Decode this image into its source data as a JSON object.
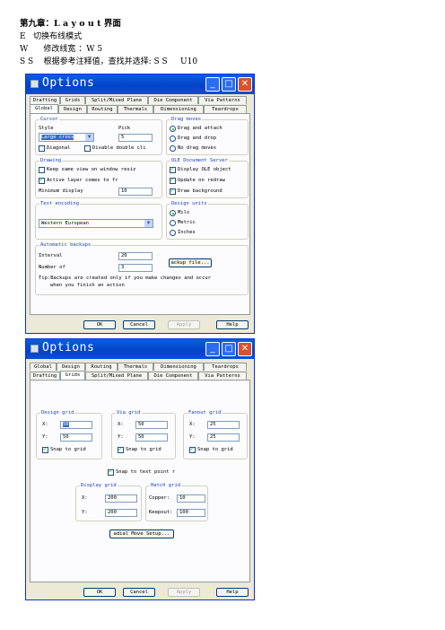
{
  "doc": {
    "heading": "第九章：L a y o u t 界面",
    "line1": "E   切换布线模式",
    "line2": "W      修改线宽 ：W 5",
    "line3": "S S    根据参考注释值，查找并选择: S S     U10"
  },
  "dialog1": {
    "title": "Options",
    "tabs_row1": [
      "Drafting",
      "Grids",
      "Split/Mixed Plane",
      "Die Component",
      "Via Patterns"
    ],
    "tabs_row2": [
      "Global",
      "Design",
      "Routing",
      "Thermals",
      "Dimensioning",
      "Teardrops"
    ],
    "cursor": {
      "label": "Cursor",
      "style_label": "Style",
      "style_value": "Large cross",
      "pick_label": "Pick",
      "pick_value": "5",
      "diagonal": "Diagonal",
      "disable_dbl": "Disable double cli"
    },
    "drag": {
      "label": "Drag moves",
      "opt1": "Drag and attach",
      "opt2": "Drag and drop",
      "opt3": "No drag moves"
    },
    "drawing": {
      "label": "Drawing",
      "keep_same": "Keep same view on window resiz",
      "active_layer": "Active layer comes to fr",
      "min_display_label": "Minimum display",
      "min_display_value": "10"
    },
    "ole": {
      "label": "OLE Document Server",
      "display": "Display OLE object",
      "update": "Update on redraw",
      "draw_bg": "Draw background"
    },
    "text_encoding": {
      "label": "Text encoding",
      "value": "Western European"
    },
    "design_units": {
      "label": "Design units",
      "mils": "Mils",
      "metric": "Metric",
      "inches": "Inches"
    },
    "backups": {
      "label": "Automatic backups",
      "interval_label": "Interval",
      "interval_value": "20",
      "number_label": "Number of",
      "number_value": "3",
      "button": "ackup file...",
      "tip1": "Tip:Backups are created only if you make changes and occur",
      "tip2": "when you finish an action"
    },
    "buttons": {
      "ok": "OK",
      "cancel": "Cancel",
      "apply": "Apply",
      "help": "Help"
    }
  },
  "dialog2": {
    "title": "Options",
    "tabs_row1": [
      "Global",
      "Design",
      "Routing",
      "Thermals",
      "Dimensioning",
      "Teardrops"
    ],
    "tabs_row2": [
      "Drafting",
      "Grids",
      "Split/Mixed Plane",
      "Die Component",
      "Via Patterns"
    ],
    "design_grid": {
      "label": "Design grid",
      "x_label": "X:",
      "x_value": "50",
      "y_label": "Y:",
      "y_value": "50",
      "snap": "Snap to grid"
    },
    "via_grid": {
      "label": "Via grid",
      "x_label": "X:",
      "x_value": "50",
      "y_label": "Y:",
      "y_value": "50",
      "snap": "Snap to grid"
    },
    "fanout_grid": {
      "label": "Fanout grid",
      "x_label": "X:",
      "x_value": "25",
      "y_label": "Y:",
      "y_value": "25",
      "snap": "Snap to grid"
    },
    "snap_text": "Snap to text point r",
    "display_grid": {
      "label": "Display grid",
      "x_label": "X:",
      "x_value": "200",
      "y_label": "Y:",
      "y_value": "200"
    },
    "hatch_grid": {
      "label": "Hatch grid",
      "copper_label": "Copper:",
      "copper_value": "10",
      "keepout_label": "Keepout:",
      "keepout_value": "100"
    },
    "radial_button": "adial Move Setup...",
    "buttons": {
      "ok": "OK",
      "cancel": "Cancel",
      "apply": "Apply",
      "help": "Help"
    }
  },
  "colors": {
    "titlebar": "#0342c9",
    "groupbox_title": "#1b3fb8",
    "close_button": "#d9522b"
  }
}
